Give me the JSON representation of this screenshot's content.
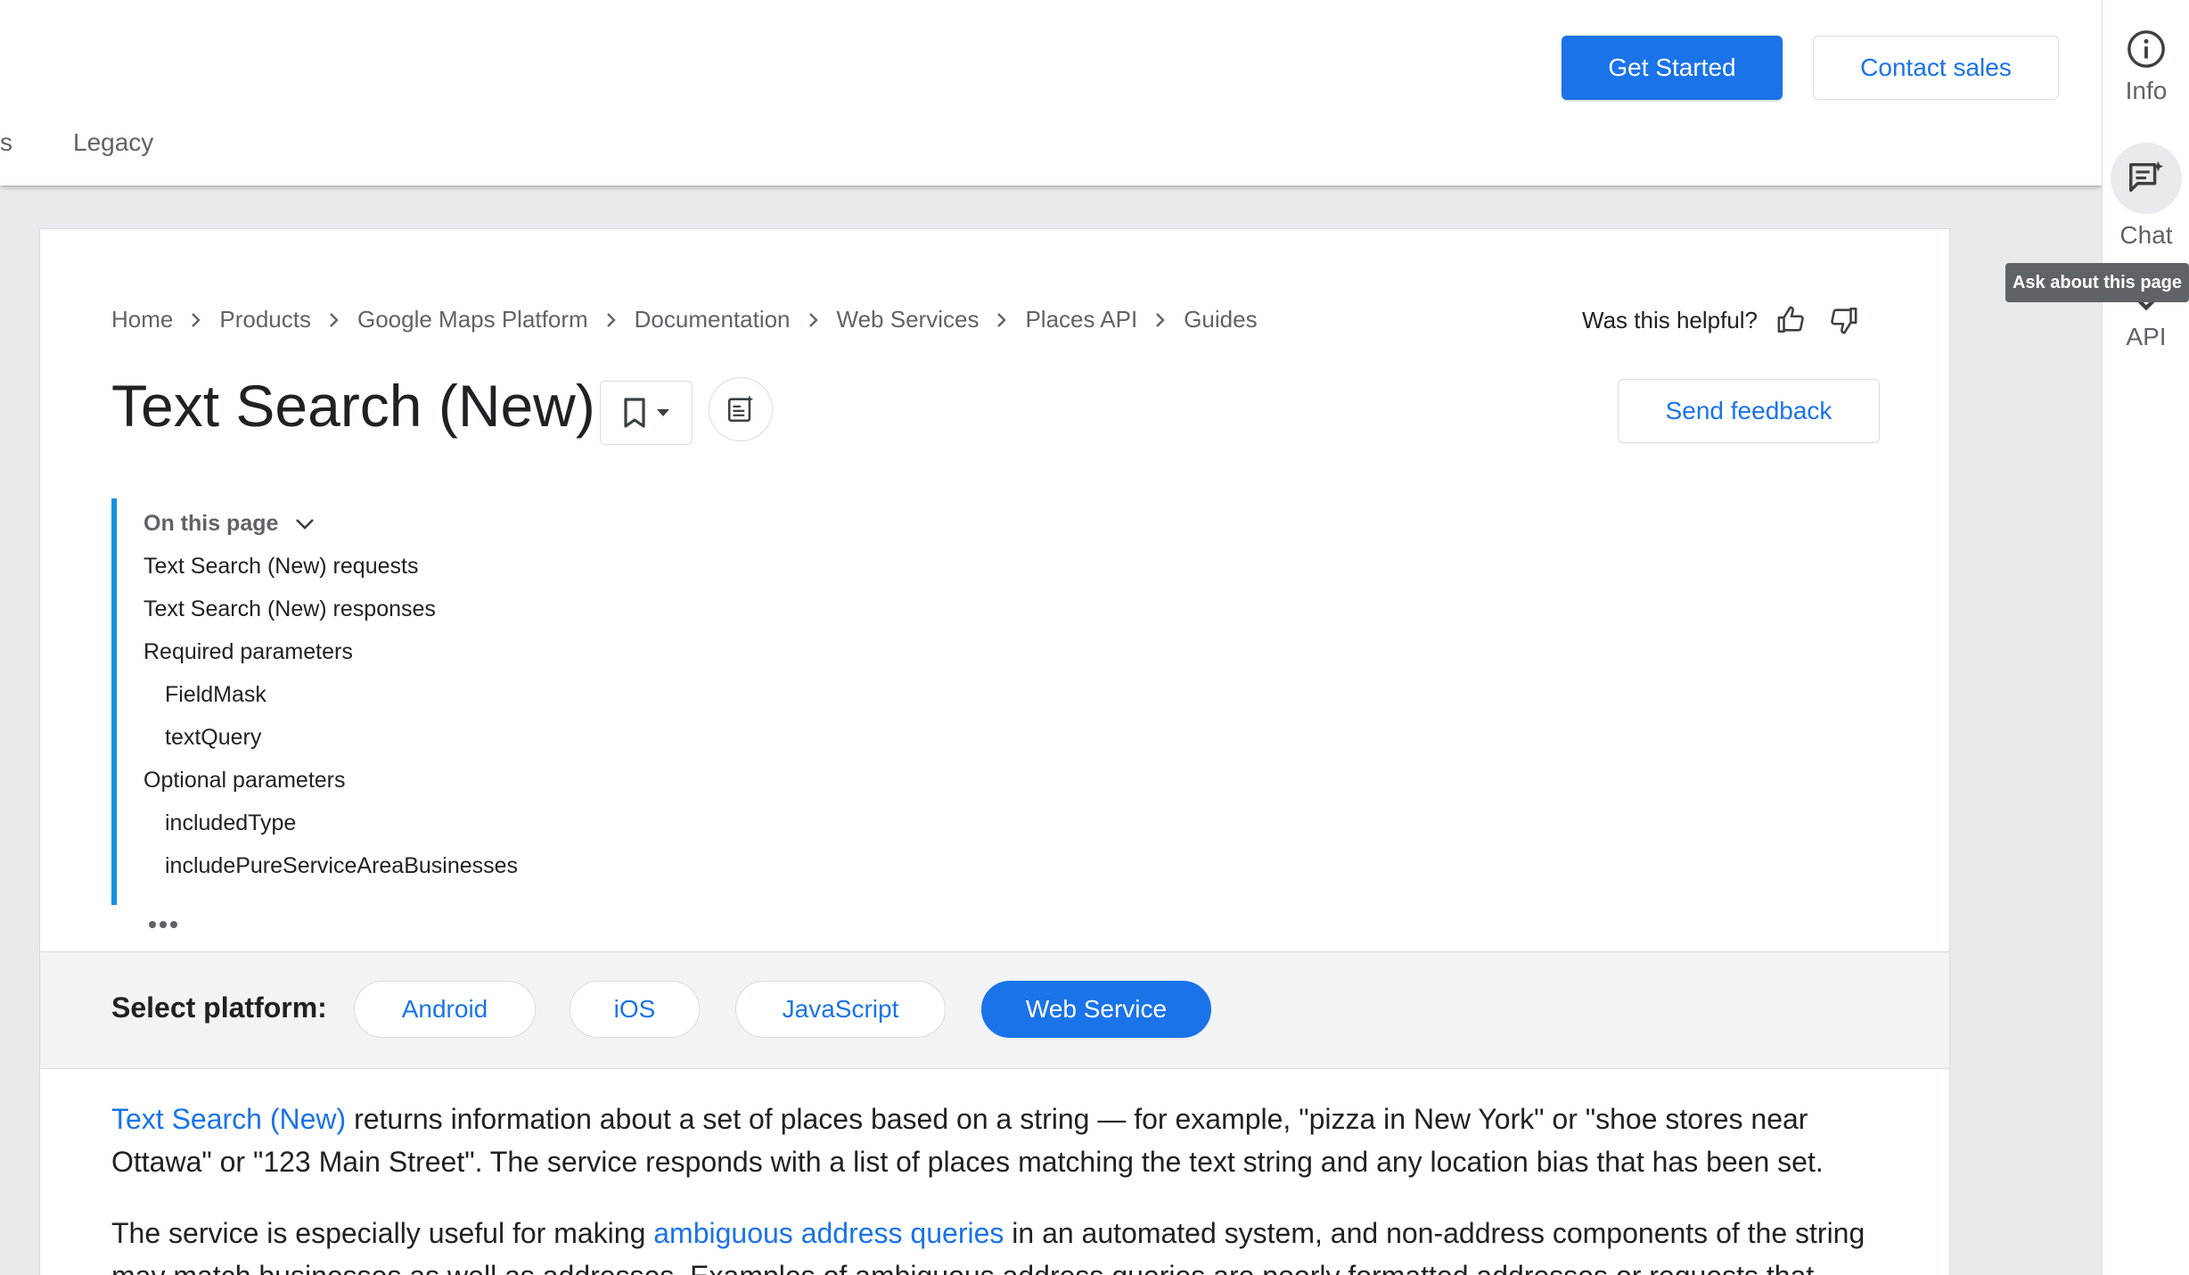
{
  "header": {
    "tab_fragment": "s",
    "tab_legacy": "Legacy",
    "get_started": "Get Started",
    "contact_sales": "Contact sales"
  },
  "rail": {
    "info": "Info",
    "chat": "Chat",
    "api": "API",
    "tooltip": "Ask about this page"
  },
  "breadcrumb": [
    "Home",
    "Products",
    "Google Maps Platform",
    "Documentation",
    "Web Services",
    "Places API",
    "Guides"
  ],
  "helpful": "Was this helpful?",
  "title": "Text Search (New)",
  "send_feedback": "Send feedback",
  "toc": {
    "heading": "On this page",
    "items": [
      {
        "label": "Text Search (New) requests",
        "sub": false
      },
      {
        "label": "Text Search (New) responses",
        "sub": false
      },
      {
        "label": "Required parameters",
        "sub": false
      },
      {
        "label": "FieldMask",
        "sub": true
      },
      {
        "label": "textQuery",
        "sub": true
      },
      {
        "label": "Optional parameters",
        "sub": false
      },
      {
        "label": "includedType",
        "sub": true
      },
      {
        "label": "includePureServiceAreaBusinesses",
        "sub": true
      }
    ]
  },
  "platform": {
    "label": "Select platform:",
    "options": [
      "Android",
      "iOS",
      "JavaScript",
      "Web Service"
    ],
    "selected": "Web Service"
  },
  "body": {
    "p1_link": "Text Search (New)",
    "p1_text": " returns information about a set of places based on a string — for example, \"pizza in New York\" or \"shoe stores near Ottawa\" or \"123 Main Street\". The service responds with a list of places matching the text string and any location bias that has been set.",
    "p2_before": "The service is especially useful for making ",
    "p2_link": "ambiguous address queries",
    "p2_after": " in an automated system, and non-address components of the string may match businesses as well as addresses. Examples of ambiguous address queries are poorly formatted addresses or requests that"
  },
  "colors": {
    "accent": "#1a73e8",
    "toc_bar": "#1a8fe0"
  }
}
